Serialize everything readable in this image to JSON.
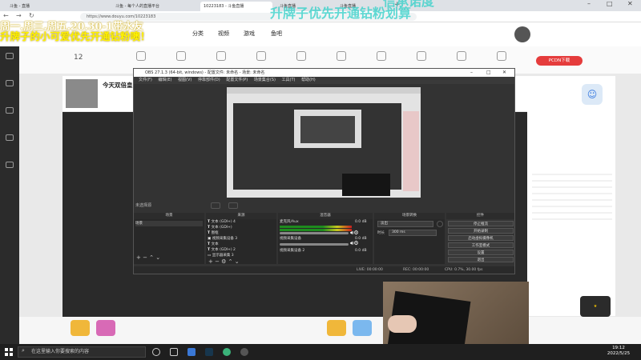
{
  "browser": {
    "tabs": [
      {
        "label": "斗鱼 - 直播"
      },
      {
        "label": "斗鱼 - 每个人的直播平台"
      },
      {
        "label": "10223183 - 斗鱼直播"
      },
      {
        "label": "斗鱼直播"
      },
      {
        "label": "斗鱼直播"
      }
    ],
    "url": "https://www.douyu.com/10223183"
  },
  "overlay": {
    "schedule_line1": "周一.周三.周五.20.30-1带水友",
    "schedule_line2": "升牌子的小可爱优先开通钻粉噢！",
    "top_line1": "信承诺度",
    "top_line2": "升牌子优先开通钻粉划算"
  },
  "site": {
    "nav_category": "分类",
    "nav_video": "视频",
    "nav_game": "游戏",
    "nav_fishball": "鱼吧",
    "room_title": "今天双倍皇",
    "badge": "12",
    "pcdn": "PCDN下载"
  },
  "obs": {
    "title": "OBS 27.1.3 (64-bit, windows) - 配置文件: 未命名 - 场景: 未命名",
    "menu": [
      "文件(F)",
      "编辑(E)",
      "视图(V)",
      "停靠部件(D)",
      "配置文件(P)",
      "场景集合(S)",
      "工具(T)",
      "帮助(H)"
    ],
    "source_selected": "未选择源",
    "docks": {
      "scenes": "场景",
      "sources": "来源",
      "mixer": "混音器",
      "transitions": "场景转换",
      "controls": "控件"
    },
    "scene_items": [
      "场景"
    ],
    "source_items": [
      "文本 (GDI+) 4",
      "文本 (GDI+)",
      "图框",
      "视频采集设备 3",
      "文本",
      "文本 (GDI+) 2",
      "显示器采集 3"
    ],
    "mixer_items": [
      {
        "name": "麦克风/Aux",
        "db": "0.0 dB"
      },
      {
        "name": "视频采集设备",
        "db": "0.0 dB"
      },
      {
        "name": "视频采集设备 2",
        "db": "0.0 dB"
      }
    ],
    "transition": "淡出",
    "duration_label": "时长",
    "duration": "300 ms",
    "controls": [
      "停止推流",
      "开始录制",
      "启动虚拟摄像机",
      "工作室模式",
      "设置",
      "退出"
    ],
    "status": {
      "live": "LIVE: 00:00:00",
      "rec": "REC: 00:00:00",
      "cpu": "CPU: 0.7%, 30.00 fps"
    }
  },
  "taskbar": {
    "search_placeholder": "在这里输入你要搜索的内容",
    "time": "19:12",
    "date": "2022/5/25"
  }
}
